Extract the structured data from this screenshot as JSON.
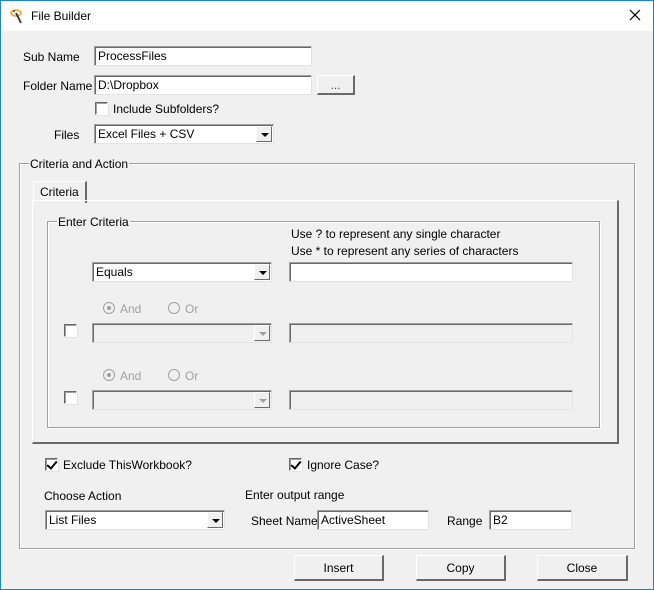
{
  "window": {
    "title": "File Builder",
    "close_label": "×"
  },
  "form": {
    "sub_name_label": "Sub Name",
    "sub_name_value": "ProcessFiles",
    "folder_name_label": "Folder Name",
    "folder_name_value": "D:\\Dropbox",
    "browse_label": "...",
    "include_subfolders_label": "Include Subfolders?",
    "include_subfolders_checked": false,
    "files_label": "Files",
    "files_value": "Excel Files + CSV"
  },
  "criteria_action": {
    "caption": "Criteria and Action",
    "tabs": [
      {
        "label": "Criteria",
        "active": true
      }
    ],
    "enter_criteria": {
      "caption": "Enter Criteria",
      "hint_line_1": "Use ? to represent any single character",
      "hint_line_2": "Use * to represent any series of characters",
      "rows": [
        {
          "operator": "Equals",
          "value": "",
          "enabled": true
        },
        {
          "enabled": false,
          "checked": false,
          "and_label": "And",
          "or_label": "Or",
          "and_selected": true,
          "operator": "",
          "value": ""
        },
        {
          "enabled": false,
          "checked": false,
          "and_label": "And",
          "or_label": "Or",
          "and_selected": true,
          "operator": "",
          "value": ""
        }
      ]
    },
    "exclude_thisworkbook_label": "Exclude ThisWorkbook?",
    "exclude_thisworkbook_checked": true,
    "ignore_case_label": "Ignore Case?",
    "ignore_case_checked": true,
    "choose_action_label": "Choose Action",
    "action_value": "List Files",
    "output_range_label": "Enter output range",
    "sheet_name_label": "Sheet Name",
    "sheet_name_value": "ActiveSheet",
    "range_label": "Range",
    "range_value": "B2"
  },
  "buttons": {
    "insert": "Insert",
    "copy": "Copy",
    "close": "Close"
  }
}
